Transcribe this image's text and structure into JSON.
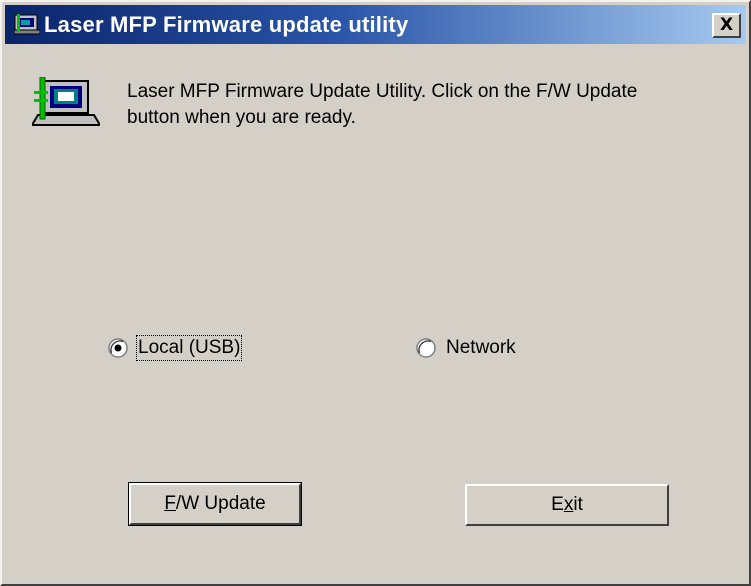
{
  "window": {
    "title": "Laser MFP Firmware update utility",
    "close_label": "X"
  },
  "message": {
    "text": "Laser MFP Firmware Update Utility. Click on the F/W Update button when you are ready."
  },
  "connection": {
    "options": [
      {
        "label": "Local (USB)",
        "selected": true
      },
      {
        "label": "Network",
        "selected": false
      }
    ]
  },
  "buttons": {
    "update": {
      "label_mnemonic": "F",
      "label_rest": "/W Update"
    },
    "exit": {
      "label_before": "E",
      "label_mnemonic": "x",
      "label_after": "it"
    }
  },
  "colors": {
    "titlebar_start": "#0a246a",
    "titlebar_end": "#a6caf0",
    "dialog_face": "#d4d0c8"
  },
  "icons": {
    "title": "computer-firmware-icon",
    "app": "computer-firmware-icon",
    "close": "close-icon"
  }
}
